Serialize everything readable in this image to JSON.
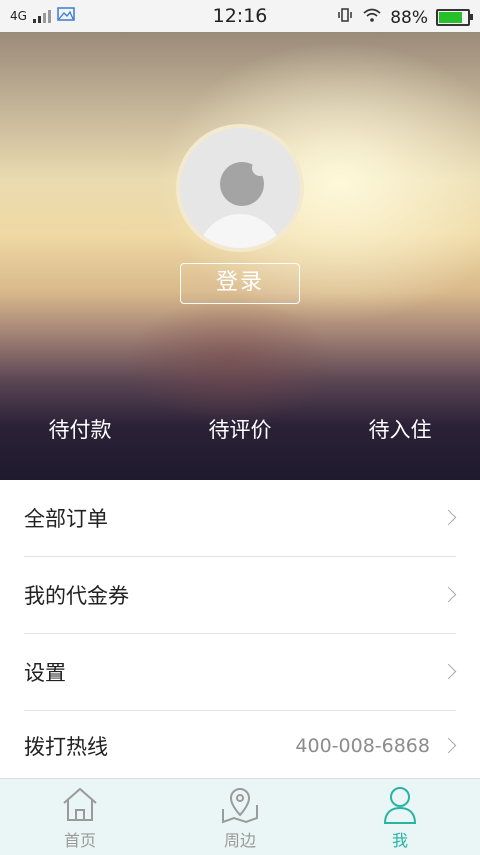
{
  "status_bar": {
    "network": "4G",
    "time": "12:16",
    "battery": "88%",
    "battery_level": 0.88,
    "icons": [
      "signal-icon",
      "gallery-icon",
      "vibrate-icon",
      "wifi-icon",
      "battery-icon"
    ],
    "battery_color": "#27c02a"
  },
  "profile": {
    "login_label": "登录",
    "avatar_icon": "default-avatar-icon"
  },
  "order_tabs": [
    {
      "label": "待付款"
    },
    {
      "label": "待评价"
    },
    {
      "label": "待入住"
    }
  ],
  "menu": [
    {
      "label": "全部订单",
      "icon": "chevron-right-icon"
    },
    {
      "label": "我的代金券",
      "icon": "chevron-right-icon"
    },
    {
      "label": "设置",
      "icon": "chevron-right-icon"
    },
    {
      "label": "拨打热线",
      "value": "400-008-6868",
      "icon": "chevron-right-icon"
    }
  ],
  "bottom_nav": [
    {
      "label": "首页",
      "icon": "home-icon",
      "active": false
    },
    {
      "label": "周边",
      "icon": "map-icon",
      "active": false
    },
    {
      "label": "我",
      "icon": "user-icon",
      "active": true
    }
  ],
  "colors": {
    "accent": "#28b3a3",
    "nav_background": "#eaf6f5",
    "inactive_nav": "#9a9a9a"
  }
}
